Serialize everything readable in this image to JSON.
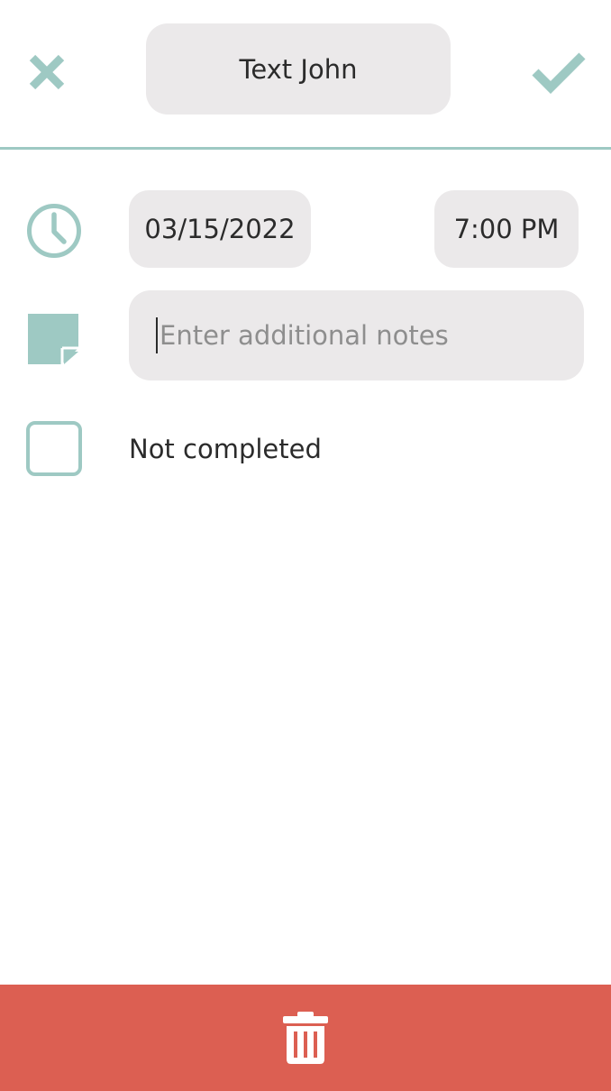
{
  "header": {
    "title_value": "Text John",
    "cancel_icon": "close-icon",
    "confirm_icon": "checkmark-icon"
  },
  "schedule": {
    "icon": "clock-icon",
    "date": "03/15/2022",
    "time": "7:00 PM"
  },
  "notes": {
    "icon": "sticky-note-icon",
    "placeholder": "Enter additional notes",
    "value": ""
  },
  "completion": {
    "checked": false,
    "label": "Not completed"
  },
  "footer": {
    "delete_icon": "trash-icon"
  },
  "colors": {
    "accent": "#9ec9c3",
    "field_bg": "#ebe9ea",
    "danger": "#dc5f52",
    "text": "#2b2b2b",
    "placeholder": "#8e8e8e"
  }
}
